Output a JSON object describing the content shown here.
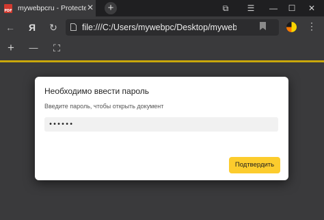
{
  "tab": {
    "favicon_label": "PDF",
    "title": "mywebpcru - Protected",
    "close_glyph": "✕",
    "new_tab_glyph": "+"
  },
  "window_controls": {
    "extensions_glyph": "⧉",
    "collections_glyph": "☰",
    "minimize_glyph": "—",
    "maximize_glyph": "☐",
    "close_glyph": "✕"
  },
  "navigation": {
    "back_glyph": "←",
    "yandex_glyph": "Я",
    "reload_glyph": "↻",
    "url": "file:///C:/Users/mywebpc/Desktop/myweb...",
    "menu_glyph": "⋮"
  },
  "pdf_toolbar": {
    "zoom_in_glyph": "+",
    "zoom_out_glyph": "—",
    "fit_glyph": "⛶"
  },
  "dialog": {
    "title": "Необходимо ввести пароль",
    "subtitle": "Введите пароль, чтобы открыть документ",
    "password_value": "••••••",
    "confirm_label": "Подтвердить"
  },
  "colors": {
    "accent_yellow": "#fccc2d",
    "progress": "#c9a70b",
    "background": "#3a3a3c"
  },
  "icons": [
    "pdf-icon",
    "close-icon",
    "new-tab-icon",
    "back-icon",
    "yandex-icon",
    "reload-icon",
    "file-icon",
    "bookmark-icon",
    "menu-icon",
    "zoom-in-icon",
    "zoom-out-icon",
    "fit-page-icon"
  ]
}
